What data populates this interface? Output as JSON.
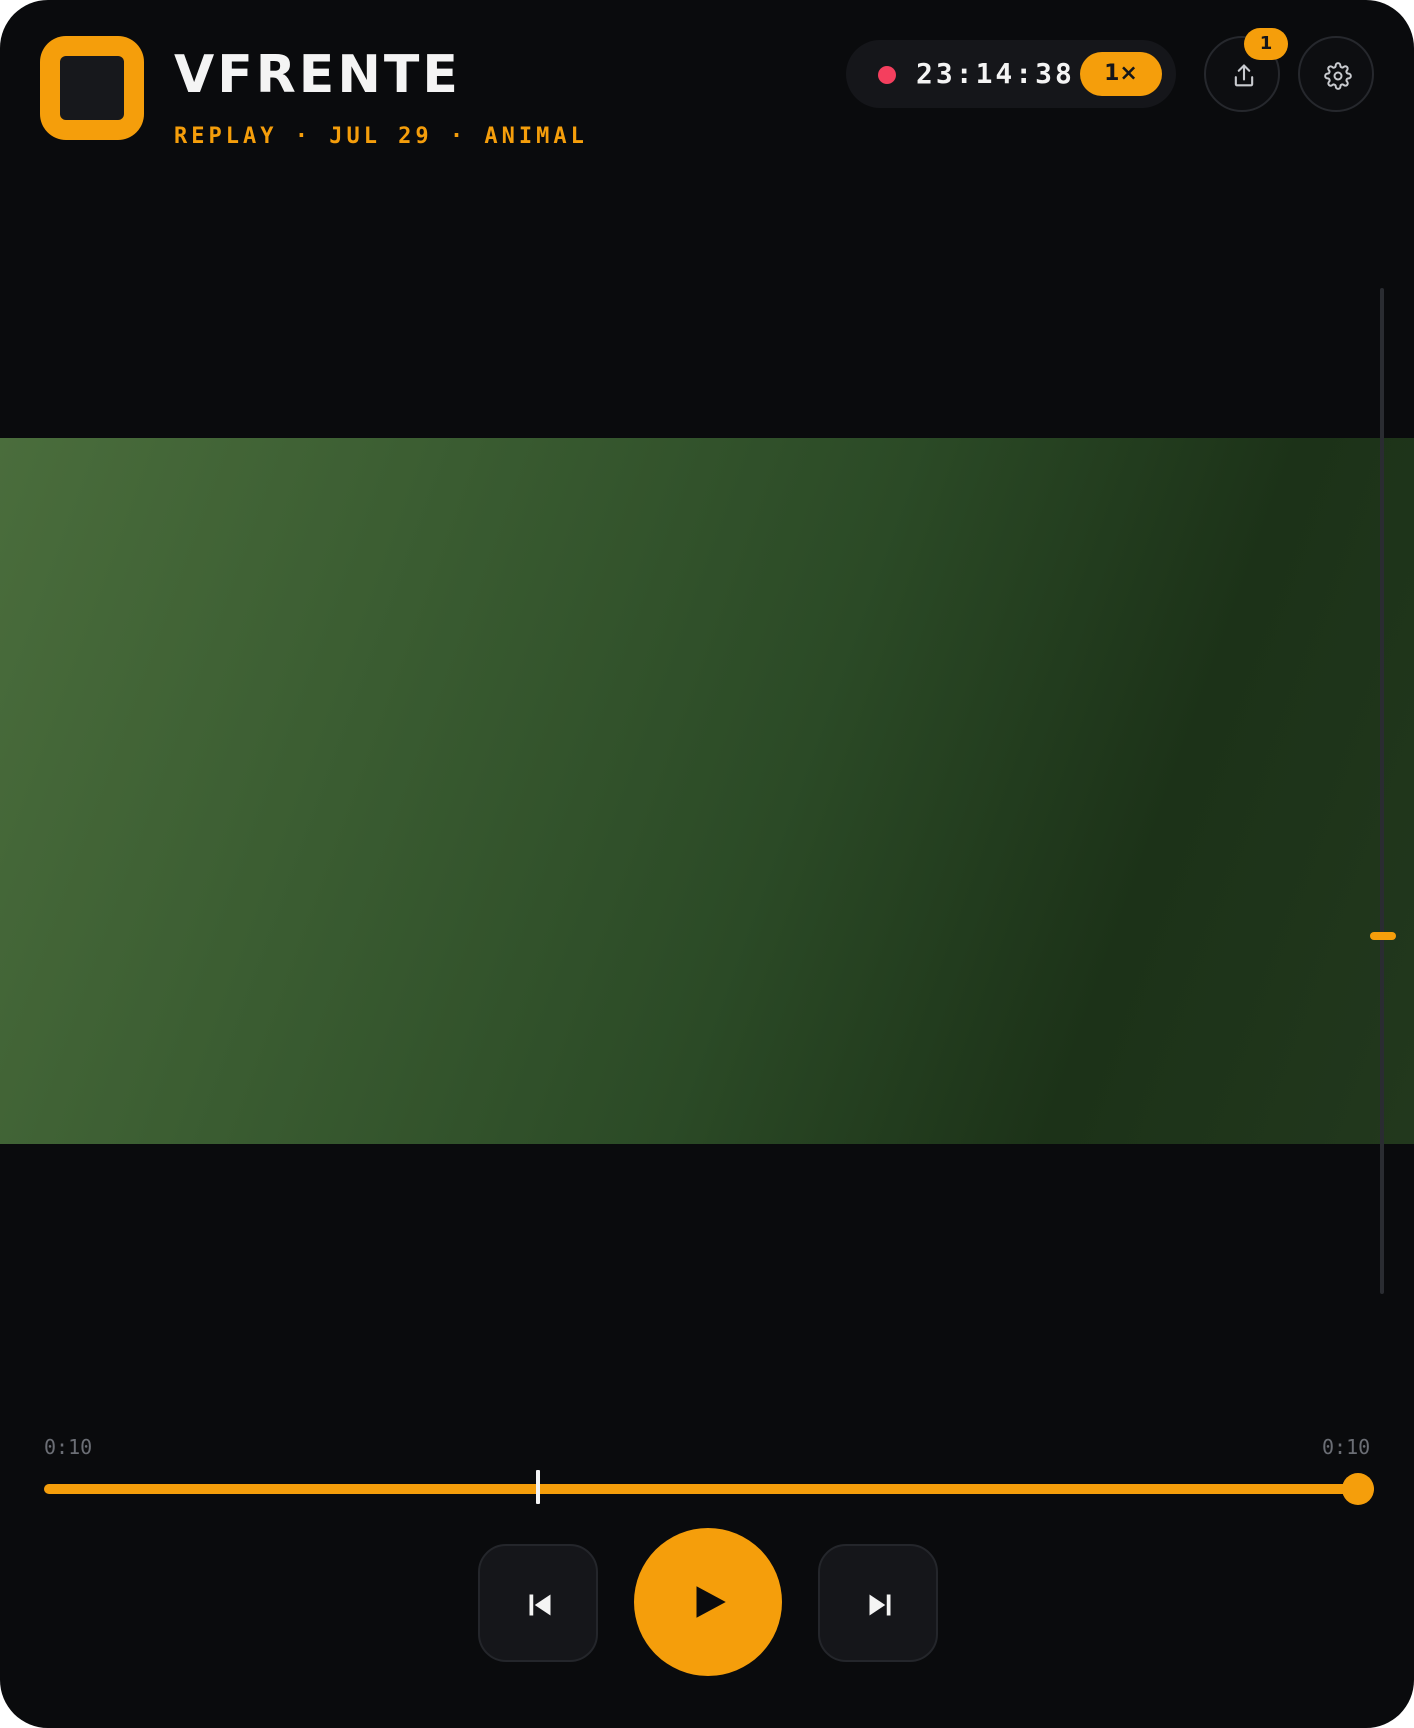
{
  "header": {
    "title": "VFRENTE",
    "subtitle": "REPLAY · JUL 29 · ANIMAL",
    "logo_icon": "app-logo-square-icon"
  },
  "status": {
    "recording_indicator": "recording-dot-icon",
    "clock": "23:14:38",
    "speed": "1×"
  },
  "actions": {
    "export_icon": "share-upload-icon",
    "export_badge": "1",
    "settings_icon": "gear-icon"
  },
  "video": {
    "vertical_scrub_position": 0.64
  },
  "timeline": {
    "current_time": "0:10",
    "total_time": "0:10",
    "progress_fraction": 1.0,
    "marker_fraction": 0.37
  },
  "transport": {
    "previous_icon": "skip-back-icon",
    "play_icon": "play-icon",
    "next_icon": "skip-forward-icon"
  },
  "colors": {
    "accent": "#f59e0b",
    "background": "#0a0b0d",
    "recording": "#f43f5e"
  }
}
